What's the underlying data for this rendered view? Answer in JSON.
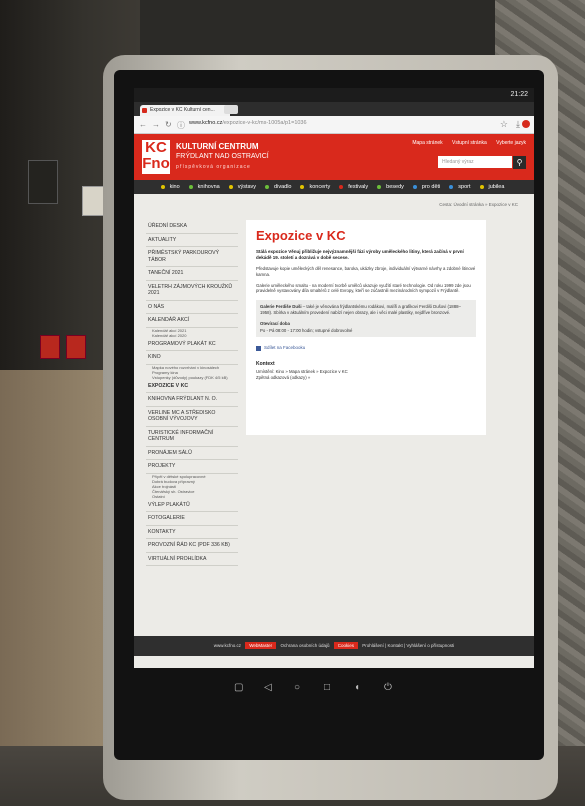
{
  "statusbar": {
    "time": "21:22"
  },
  "browser": {
    "tab_title": "Expozice v KC Kulturní cen...",
    "url_host": "www.kcfno.cz",
    "url_path": "/expozice-v-kc/ms-1005a/p1=1036"
  },
  "header": {
    "logo": "KC Fno",
    "org_name": "KULTURNÍ CENTRUM",
    "org_sub": "FRÝDLANT NAD OSTRAVICÍ",
    "org_type": "příspěvková organizace",
    "link1": "Mapa stránek",
    "link2": "Vstupní stránka",
    "link3": "Vyberte jazyk",
    "search_placeholder": "Hledaný výraz"
  },
  "mainnav": [
    "kino",
    "knihovna",
    "výstavy",
    "divadlo",
    "koncerty",
    "festivaly",
    "besedy",
    "pro děti",
    "sport",
    "jubilea"
  ],
  "mainnav_colors": [
    "#e2c400",
    "#6cbf3a",
    "#e2c400",
    "#6cbf3a",
    "#e2c400",
    "#d9291c",
    "#6cbf3a",
    "#3a8fd9",
    "#3a8fd9",
    "#e2c400"
  ],
  "breadcrumb": "Cesta: Úvodní stránka » Expozice v KC",
  "sidebar": [
    {
      "label": "ÚŘEDNÍ DESKA"
    },
    {
      "label": "AKTUALITY"
    },
    {
      "label": "PŘIMĚSTSKÝ PARKOUROVÝ TÁBOR"
    },
    {
      "label": "TANEČNÍ 2021"
    },
    {
      "label": "VELETRH ZÁJMOVÝCH KROUŽKŮ 2021"
    },
    {
      "label": "O NÁS"
    },
    {
      "label": "KALENDÁŘ AKCÍ",
      "subs": [
        "Kalendář akcí 2021",
        "Kalendář akcí 2020"
      ]
    },
    {
      "label": "PROGRAMOVÝ PLAKÁT KC"
    },
    {
      "label": "KINO",
      "subs": [
        "Mapka nového rozvrhání v kinosálech",
        "Programy kina",
        "Vstupenky (důvody) poukazy (FDK 4/5 kB)"
      ]
    },
    {
      "label": "EXPOZICE V KC",
      "active": true
    },
    {
      "label": "KNIHOVNA FRÝDLANT N. O."
    },
    {
      "label": "VERLINE MC A STŘEDISKO OSOBNÍ VÝVOJOVY"
    },
    {
      "label": "TURISTICKÉ INFORMAČNÍ CENTRUM"
    },
    {
      "label": "PRONÁJEM SÁLŮ"
    },
    {
      "label": "PROJEKTY",
      "subs": [
        "Přípěl v dětské spolupracovné",
        "Dobrá budova přípravný",
        "Akce trojnásti",
        "Čtenářský sh. Ostravice",
        "Ostatní"
      ]
    },
    {
      "label": "VÝLEP PLAKÁTŮ"
    },
    {
      "label": "FOTOGALERIE"
    },
    {
      "label": "KONTAKTY"
    },
    {
      "label": "PROVOZNÍ ŘÁD KC (PDF 336 KB)"
    },
    {
      "label": "VIRTUÁLNÍ PROHLÍDKA"
    }
  ],
  "content": {
    "title": "Expozice v KC",
    "intro": "Stálá expozice Věnuj přibližuje nejvýznamnější fázi výroby uměleckého litiny, která začíná v první dekádě 19. století a dozrává v době secese.",
    "p1": "Představuje kopie uměleckých děl renesance, baroka, ukázky zbroje, individuální výtvarné návrhy a zdobné litinové kamna.",
    "p2": "Galerie uměleckého smaltu - na moderní tvorbě umělců ukazuje využití staré technologie. Od roku 1999 zde jsou pravidelně vystavovány díla smaltérů z celé Evropy, kteří se zúčastnili mezinárodních sympozií v Frýdlantě.",
    "p3_label": "Galerie Ferdiše Duši",
    "p3": " – také je věnována frýdlantskému rodákovi, malíři a grafikovi Ferdiši Dušovi (1888–1958). Sbírka v aktuálním provedení nabízí nejen obrazy, ale i věci malé plastiky, nejdříve bronzové.",
    "hours_label": "Otevírací doba",
    "hours": "Po - Pá 08:00 - 17:00 hodin; vstupné dobrovolné",
    "fb": "Sdílet na Facebooku",
    "contact_label": "Kontext",
    "contact_line1": "Umístění: Kino » Mapa stránek » Expozice v KC",
    "contact_line2": "Zpětná odkazová (odkazy) »"
  },
  "footer": {
    "pre": "www.kcfno.cz",
    "link_a": "WebMaster",
    "mid": "Ochrana osobních údajů",
    "link_b": "Cookies",
    "post": "Prohlášení | Kontakt | Vyhlášení o přístupnosti"
  }
}
